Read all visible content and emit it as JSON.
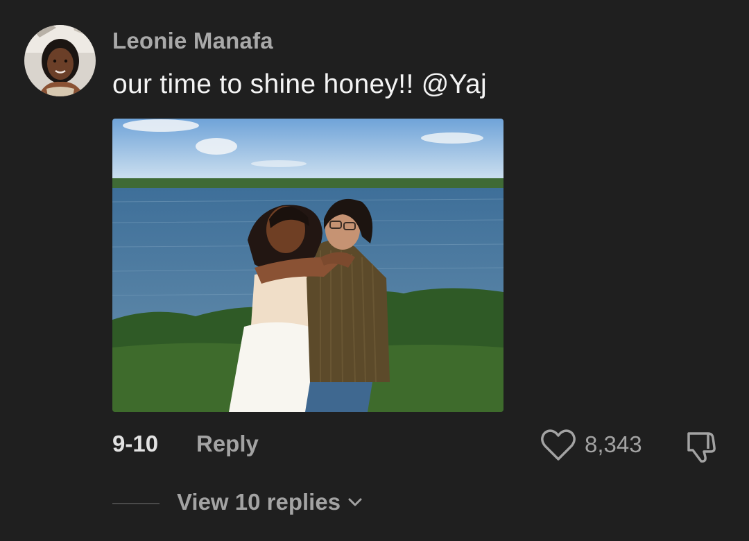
{
  "comment": {
    "username": "Leonie Manafa",
    "text": "our time to shine honey!! @Yaj",
    "date": "9-10",
    "reply_label": "Reply",
    "like_count": "8,343",
    "view_replies_label": "View 10 replies"
  },
  "icons": {
    "like": "heart-icon",
    "dislike": "thumbs-down-icon",
    "expand": "chevron-down-icon"
  },
  "colors": {
    "background": "#1f1f1f",
    "username": "#a9a9a9",
    "comment_text": "#f4f4f4",
    "secondary_text": "#a3a3a3",
    "date_text": "#e2e2e2"
  }
}
